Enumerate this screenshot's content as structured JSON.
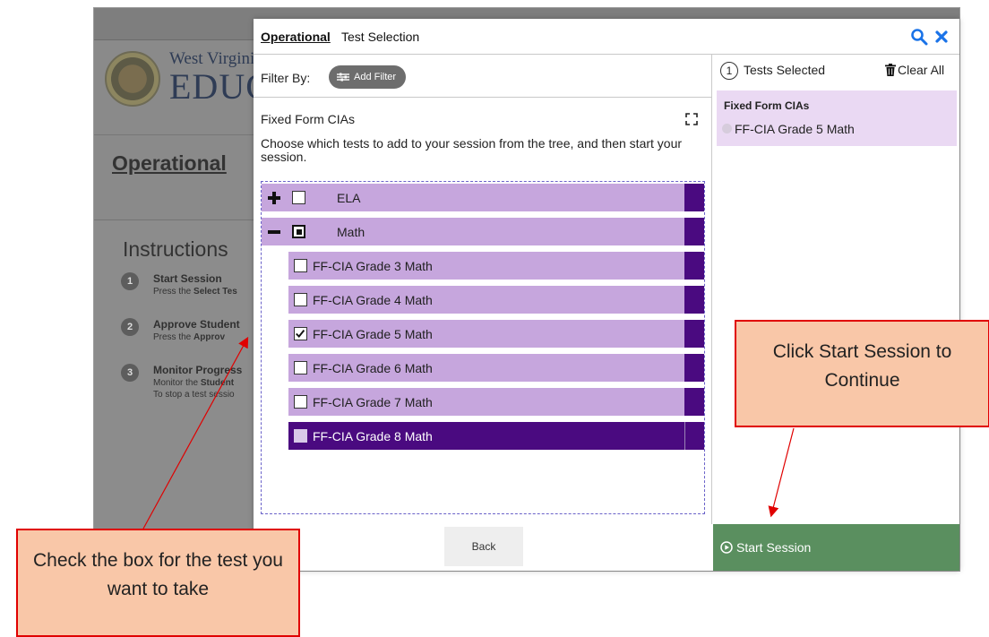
{
  "background_app": {
    "org_line1": "West Virgini",
    "org_line2": "EDUC",
    "page_title": "Operational",
    "instructions_title": "Instructions",
    "steps": [
      {
        "num": "1",
        "name": "Start Session",
        "desc_prefix": "Press the ",
        "desc_bold": "Select Tes",
        "desc2": ""
      },
      {
        "num": "2",
        "name": "Approve Student",
        "desc_prefix": "Press the ",
        "desc_bold": "Approv",
        "desc2": ""
      },
      {
        "num": "3",
        "name": "Monitor Progress",
        "desc_prefix": "Monitor the ",
        "desc_bold": "Student",
        "desc2": "To stop a test sessio"
      }
    ]
  },
  "dialog": {
    "title_strong": "Operational",
    "title_rest": "Test Selection",
    "filter_label": "Filter By:",
    "add_filter_label": "Add Filter",
    "group_title": "Fixed Form CIAs",
    "group_description": "Choose which tests to add to your session from the tree, and then start your session.",
    "tree": [
      {
        "label": "ELA",
        "level": "parent",
        "expanded": false,
        "checked": "none"
      },
      {
        "label": "Math",
        "level": "parent",
        "expanded": true,
        "checked": "partial"
      },
      {
        "label": "FF-CIA Grade 3 Math",
        "level": "child",
        "checked": "none"
      },
      {
        "label": "FF-CIA Grade 4 Math",
        "level": "child",
        "checked": "none"
      },
      {
        "label": "FF-CIA Grade 5 Math",
        "level": "child",
        "checked": "checked"
      },
      {
        "label": "FF-CIA Grade 6 Math",
        "level": "child",
        "checked": "none"
      },
      {
        "label": "FF-CIA Grade 7 Math",
        "level": "child",
        "checked": "none"
      },
      {
        "label": "FF-CIA Grade 8 Math",
        "level": "child",
        "checked": "none",
        "highlighted": true
      }
    ],
    "back_label": "Back",
    "selected_count": "1",
    "tests_selected_label": "Tests Selected",
    "clear_all_label": "Clear All",
    "selected_group": "Fixed Form CIAs",
    "selected_item": "FF-CIA Grade 5 Math",
    "start_session_label": "Start Session"
  },
  "callouts": {
    "start": "Click Start Session to Continue",
    "check": "Check the box for the test you want to take"
  },
  "colors": {
    "tree_row": "#c6a6dd",
    "tree_dark": "#4a0a80",
    "start_button": "#5a8f5f",
    "callout_fill": "#f9c7a8",
    "callout_border": "#e00000",
    "accent_blue": "#1a73e8"
  }
}
